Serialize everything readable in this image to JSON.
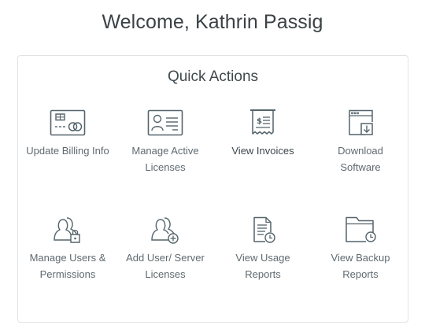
{
  "header": {
    "welcome": "Welcome, Kathrin Passig"
  },
  "quick_actions": {
    "title": "Quick Actions",
    "items": [
      {
        "id": "update-billing",
        "label": "Update Billing Info",
        "icon": "credit-card-icon"
      },
      {
        "id": "manage-licenses",
        "label": "Manage Active Licenses",
        "icon": "id-card-icon"
      },
      {
        "id": "view-invoices",
        "label": "View Invoices",
        "icon": "receipt-icon"
      },
      {
        "id": "download-software",
        "label": "Download Software",
        "icon": "download-window-icon"
      },
      {
        "id": "manage-users",
        "label": "Manage Users & Permissions",
        "icon": "users-lock-icon"
      },
      {
        "id": "add-user-licenses",
        "label": "Add User/ Server Licenses",
        "icon": "users-add-icon"
      },
      {
        "id": "view-usage-reports",
        "label": "View Usage Reports",
        "icon": "document-clock-icon"
      },
      {
        "id": "view-backup-reports",
        "label": "View Backup Reports",
        "icon": "folder-clock-icon"
      }
    ]
  },
  "colors": {
    "icon_stroke": "#55646b",
    "text": "#5f6a70",
    "border": "#dfe3e5"
  }
}
